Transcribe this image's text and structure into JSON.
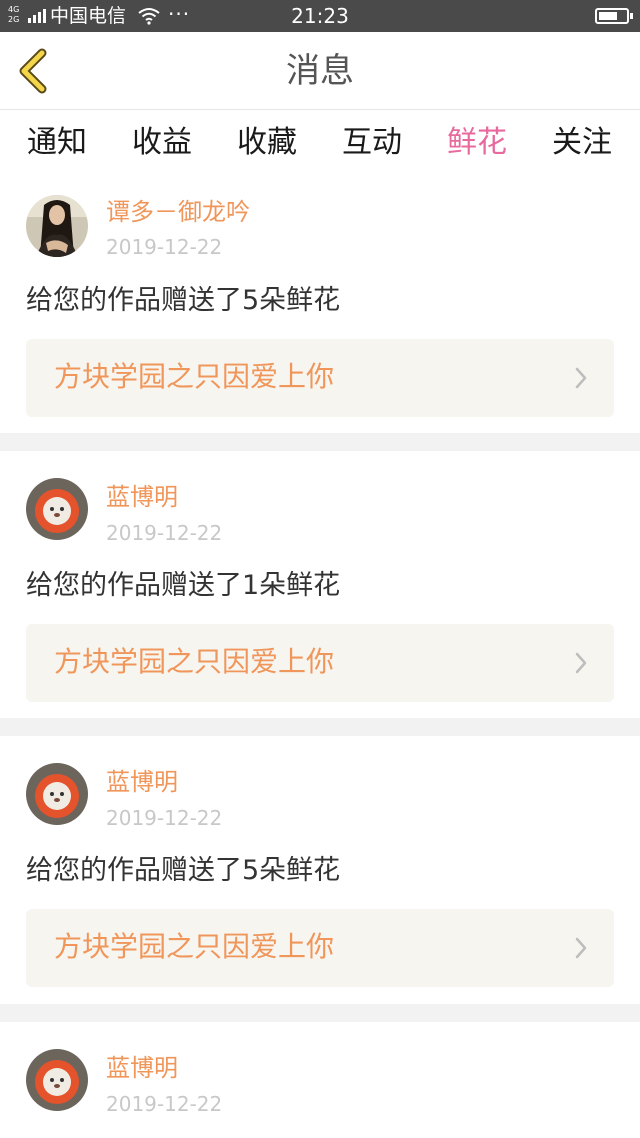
{
  "status_bar": {
    "network_top": "4G",
    "network_bottom": "2G",
    "carrier": "中国电信",
    "dots": "···",
    "time": "21:23"
  },
  "header": {
    "title": "消息",
    "back_icon": "chevron-left-icon"
  },
  "tabs": [
    {
      "label": "通知",
      "active": false
    },
    {
      "label": "收益",
      "active": false
    },
    {
      "label": "收藏",
      "active": false
    },
    {
      "label": "互动",
      "active": false
    },
    {
      "label": "鲜花",
      "active": true
    },
    {
      "label": "关注",
      "active": false
    }
  ],
  "colors": {
    "accent": "#e8699d",
    "name": "#f0965a",
    "card_bg": "#f6f5f0"
  },
  "messages": [
    {
      "user": "谭多－御龙吟",
      "date": "2019-12-22",
      "text": "给您的作品赠送了5朵鲜花",
      "work": "方块学园之只因爱上你",
      "avatar": "portrait-avatar"
    },
    {
      "user": "蓝博明",
      "date": "2019-12-22",
      "text": "给您的作品赠送了1朵鲜花",
      "work": "方块学园之只因爱上你",
      "avatar": "lion-avatar"
    },
    {
      "user": "蓝博明",
      "date": "2019-12-22",
      "text": "给您的作品赠送了5朵鲜花",
      "work": "方块学园之只因爱上你",
      "avatar": "lion-avatar"
    },
    {
      "user": "蓝博明",
      "date": "2019-12-22",
      "avatar": "lion-avatar"
    }
  ]
}
